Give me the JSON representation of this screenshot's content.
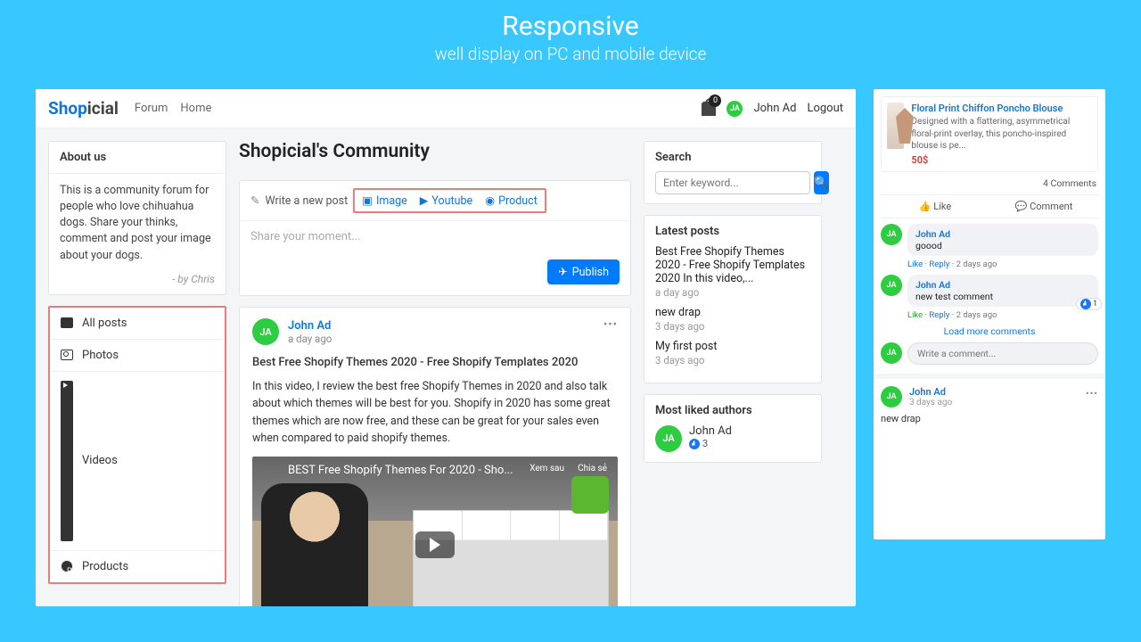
{
  "header": {
    "title": "Responsive",
    "subtitle": "well display on PC and mobile device"
  },
  "brand": {
    "a": "Shop",
    "b": "icial"
  },
  "nav": {
    "forum": "Forum",
    "home": "Home"
  },
  "topbar": {
    "notif_count": "0",
    "user_initials": "JA",
    "user": "John Ad",
    "logout": "Logout"
  },
  "about": {
    "heading": "About us",
    "text": "This is a community forum for people who love chihuahua dogs. Share your thinks, comment and post your image about your dogs.",
    "by": "- by Chris"
  },
  "cats": {
    "all": "All posts",
    "photos": "Photos",
    "videos": "Videos",
    "products": "Products"
  },
  "community": {
    "title": "Shopicial's Community"
  },
  "composer": {
    "write": "Write a new post",
    "image": "Image",
    "youtube": "Youtube",
    "product": "Product",
    "placeholder": "Share your moment...",
    "publish": "Publish"
  },
  "post": {
    "initials": "JA",
    "name": "John Ad",
    "time": "a day ago",
    "title": "Best Free Shopify Themes 2020 - Free Shopify Templates 2020",
    "body": "In this video, I review the best free Shopify Themes in 2020 and also talk about which themes will be best for you. Shopify in 2020 has some great themes which are now free, and these can be great for your sales even when compared to paid shopify themes.",
    "video_title": "BEST Free Shopify Themes For 2020 - Sho...",
    "watch_later": "Xem sau",
    "share": "Chia sẻ"
  },
  "search": {
    "heading": "Search",
    "placeholder": "Enter keyword..."
  },
  "latest": {
    "heading": "Latest posts",
    "items": [
      {
        "t": "Best Free Shopify Themes 2020 - Free Shopify Templates 2020 In this video,...",
        "d": "a day ago"
      },
      {
        "t": "new drap",
        "d": "3 days ago"
      },
      {
        "t": "My first post",
        "d": "3 days ago"
      }
    ]
  },
  "liked": {
    "heading": "Most liked authors",
    "name": "John Ad",
    "initials": "JA",
    "count": "3"
  },
  "mobile": {
    "product": {
      "name": "Floral Print Chiffon Poncho Blouse",
      "desc": "Designed with a flattering, asymmetrical floral-print overlay, this poncho-inspired blouse is pe...",
      "price": "50$"
    },
    "comments_count": "4 Comments",
    "like": "Like",
    "comment": "Comment",
    "c1": {
      "i": "JA",
      "n": "John Ad",
      "t": "goood"
    },
    "c1m": {
      "like": "Like",
      "reply": "Reply",
      "time": "2 days ago"
    },
    "c2": {
      "i": "JA",
      "n": "John Ad",
      "t": "new test comment",
      "likes": "1"
    },
    "c2m": {
      "like": "Like",
      "reply": "Reply",
      "time": "2 days ago"
    },
    "load_more": "Load more comments",
    "write_placeholder": "Write a comment...",
    "my_i": "JA",
    "post": {
      "i": "JA",
      "n": "John Ad",
      "time": "3 days ago",
      "text": "new drap"
    }
  }
}
